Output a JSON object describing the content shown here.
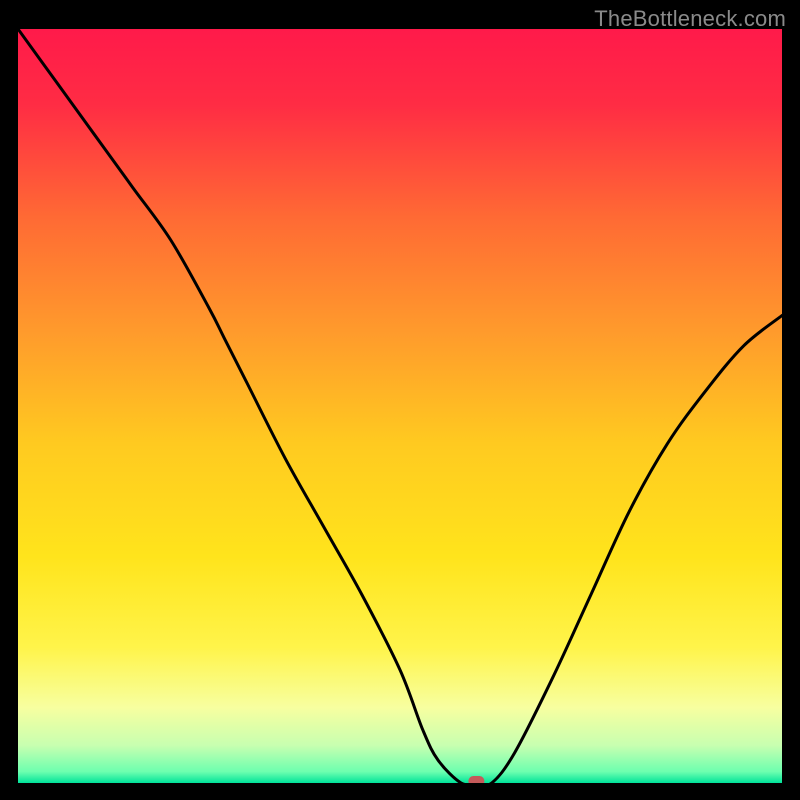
{
  "watermark": "TheBottleneck.com",
  "chart_data": {
    "type": "line",
    "title": "",
    "xlabel": "",
    "ylabel": "",
    "xlim": [
      0,
      100
    ],
    "ylim": [
      0,
      100
    ],
    "grid": false,
    "legend": false,
    "series": [
      {
        "name": "curve",
        "x": [
          0,
          5,
          10,
          15,
          20,
          25,
          27,
          30,
          35,
          40,
          45,
          50,
          53,
          55,
          58,
          60,
          62,
          65,
          70,
          75,
          80,
          85,
          90,
          95,
          100
        ],
        "y": [
          100,
          93,
          86,
          79,
          72,
          63,
          59,
          53,
          43,
          34,
          25,
          15,
          7,
          3,
          0,
          0,
          0,
          4,
          14,
          25,
          36,
          45,
          52,
          58,
          62
        ]
      }
    ],
    "marker": {
      "x": 60,
      "y": 0
    },
    "gradient_stops": [
      {
        "pos": 0.0,
        "color": "#ff1a4a"
      },
      {
        "pos": 0.1,
        "color": "#ff2c44"
      },
      {
        "pos": 0.25,
        "color": "#ff6a34"
      },
      {
        "pos": 0.4,
        "color": "#ff9a2c"
      },
      {
        "pos": 0.55,
        "color": "#ffca20"
      },
      {
        "pos": 0.7,
        "color": "#ffe41c"
      },
      {
        "pos": 0.82,
        "color": "#fff44a"
      },
      {
        "pos": 0.9,
        "color": "#f7ffa0"
      },
      {
        "pos": 0.95,
        "color": "#c8ffb0"
      },
      {
        "pos": 0.985,
        "color": "#6dffaf"
      },
      {
        "pos": 1.0,
        "color": "#00e39a"
      }
    ]
  }
}
